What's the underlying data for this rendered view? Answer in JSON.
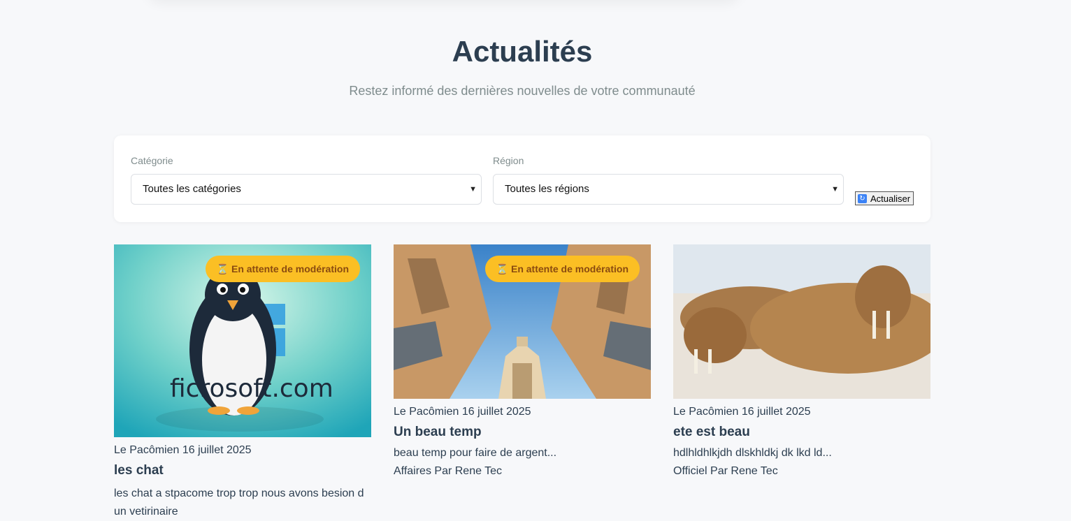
{
  "header": {
    "title": "Actualités",
    "subtitle": "Restez informé des dernières nouvelles de votre communauté"
  },
  "filters": {
    "category_label": "Catégorie",
    "category_value": "Toutes les catégories",
    "region_label": "Région",
    "region_value": "Toutes les régions",
    "refresh_label": "Actualiser"
  },
  "colors": {
    "badge": "#fbbf24",
    "title_text": "#2c3e50",
    "muted_text": "#7f8c8d"
  },
  "cards": [
    {
      "image": "penguin-windows-image",
      "image_text": "ficrosoft.com",
      "badge": "⏳ En attente de modération",
      "meta": "Le Pacômien 16 juillet 2025",
      "title": "les chat",
      "excerpt": "les chat a stpacome trop trop nous avons besion d un vetirinaire"
    },
    {
      "image": "city-buildings-sky-image",
      "badge": "⏳ En attente de modération",
      "meta": "Le Pacômien 16 juillet 2025",
      "title": "Un beau temp",
      "excerpt": "beau temp pour faire de argent...",
      "footer": "Affaires Par Rene Tec"
    },
    {
      "image": "walrus-beach-image",
      "meta": "Le Pacômien 16 juillet 2025",
      "title": "ete est beau",
      "excerpt": "hdlhldhlkjdh dlskhldkj dk lkd ld...",
      "footer": "Officiel Par Rene Tec"
    }
  ]
}
